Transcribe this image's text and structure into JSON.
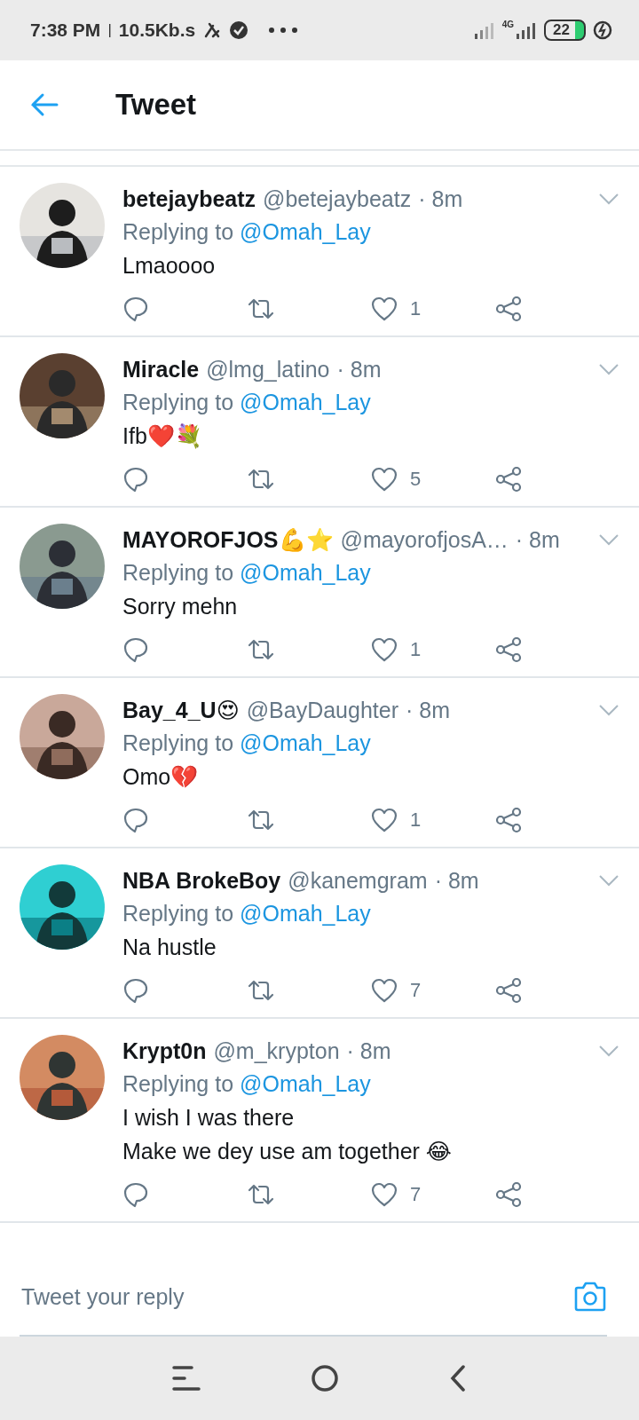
{
  "status_bar": {
    "time": "7:38 PM",
    "separator": "|",
    "speed": "10.5Kb.s",
    "network": "4G",
    "battery": "22"
  },
  "header": {
    "title": "Tweet"
  },
  "tweets": [
    {
      "name": "betejaybeatz",
      "handle": "@betejaybeatz",
      "time": "· 8m",
      "replying_label": "Replying to",
      "replying_to": "@Omah_Lay",
      "text": [
        "Lmaoooo"
      ],
      "likes": "1"
    },
    {
      "name": "Miracle",
      "handle": "@lmg_latino",
      "time": "· 8m",
      "replying_label": "Replying to",
      "replying_to": "@Omah_Lay",
      "text": [
        "Ifb❤️💐"
      ],
      "likes": "5"
    },
    {
      "name": "MAYOROFJOS💪⭐",
      "handle": "@mayorofjosA…",
      "time": "· 8m",
      "replying_label": "Replying to",
      "replying_to": "@Omah_Lay",
      "text": [
        "Sorry mehn"
      ],
      "likes": "1"
    },
    {
      "name": "Bay_4_U😍",
      "handle": "@BayDaughter",
      "time": "· 8m",
      "replying_label": "Replying to",
      "replying_to": "@Omah_Lay",
      "text": [
        "Omo💔"
      ],
      "likes": "1"
    },
    {
      "name": "NBA BrokeBoy",
      "handle": "@kanemgram",
      "time": "· 8m",
      "replying_label": "Replying to",
      "replying_to": "@Omah_Lay",
      "text": [
        "Na hustle"
      ],
      "likes": "7"
    },
    {
      "name": "Krypt0n",
      "handle": "@m_krypton",
      "time": "· 8m",
      "replying_label": "Replying to",
      "replying_to": "@Omah_Lay",
      "text": [
        "I wish I was there",
        "Make we dey use am together 😂"
      ],
      "likes": "7"
    }
  ],
  "reply_bar": {
    "placeholder": "Tweet your reply"
  }
}
